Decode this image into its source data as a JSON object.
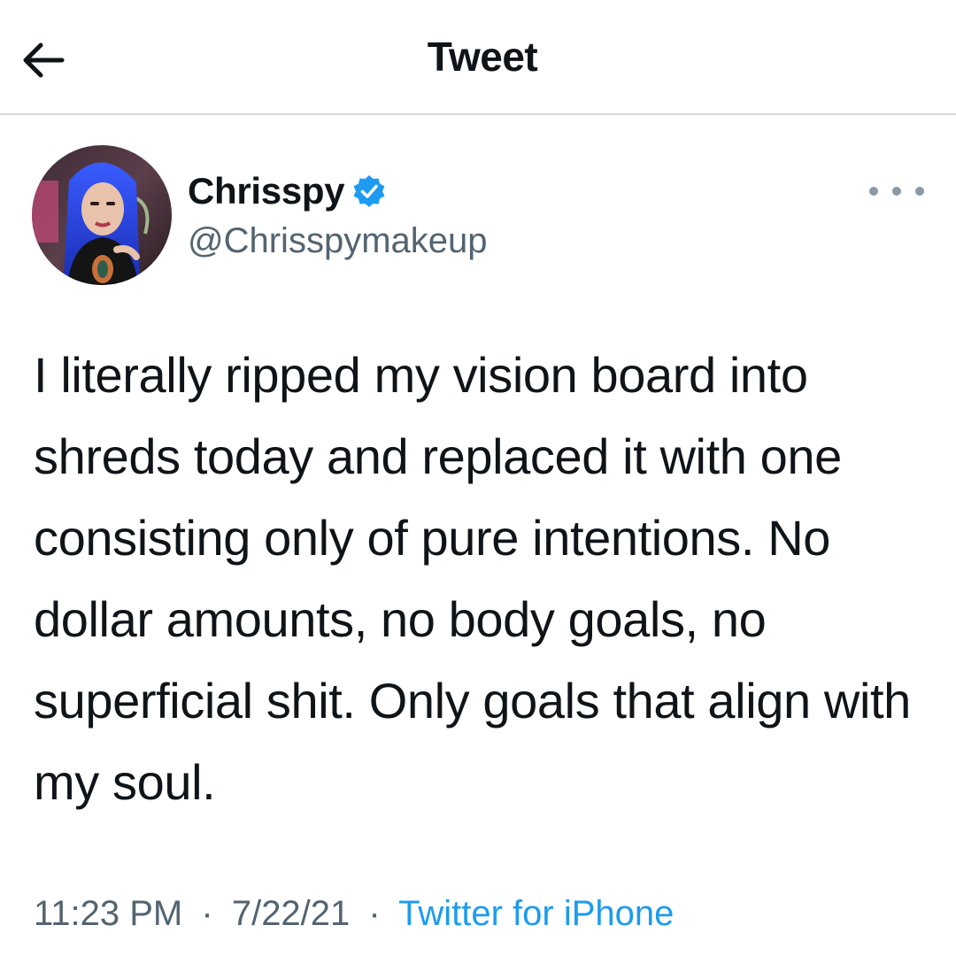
{
  "header": {
    "title": "Tweet",
    "back_icon": "arrow-left-icon"
  },
  "author": {
    "display_name": "Chrisspy",
    "handle": "@Chrisspymakeup",
    "verified": true,
    "verified_color": "#1d9bf0"
  },
  "tweet": {
    "text": "I literally ripped my vision board into shreds today and replaced it with one consisting only of pure intentions. No dollar amounts, no body goals, no superficial shit. Only goals that align with my soul."
  },
  "meta": {
    "time": "11:23 PM",
    "separator": "·",
    "date": "7/22/21",
    "source": "Twitter for iPhone"
  },
  "colors": {
    "text": "#0f1419",
    "secondary": "#536471",
    "link": "#1d9bf0",
    "divider": "#d6d9db"
  }
}
